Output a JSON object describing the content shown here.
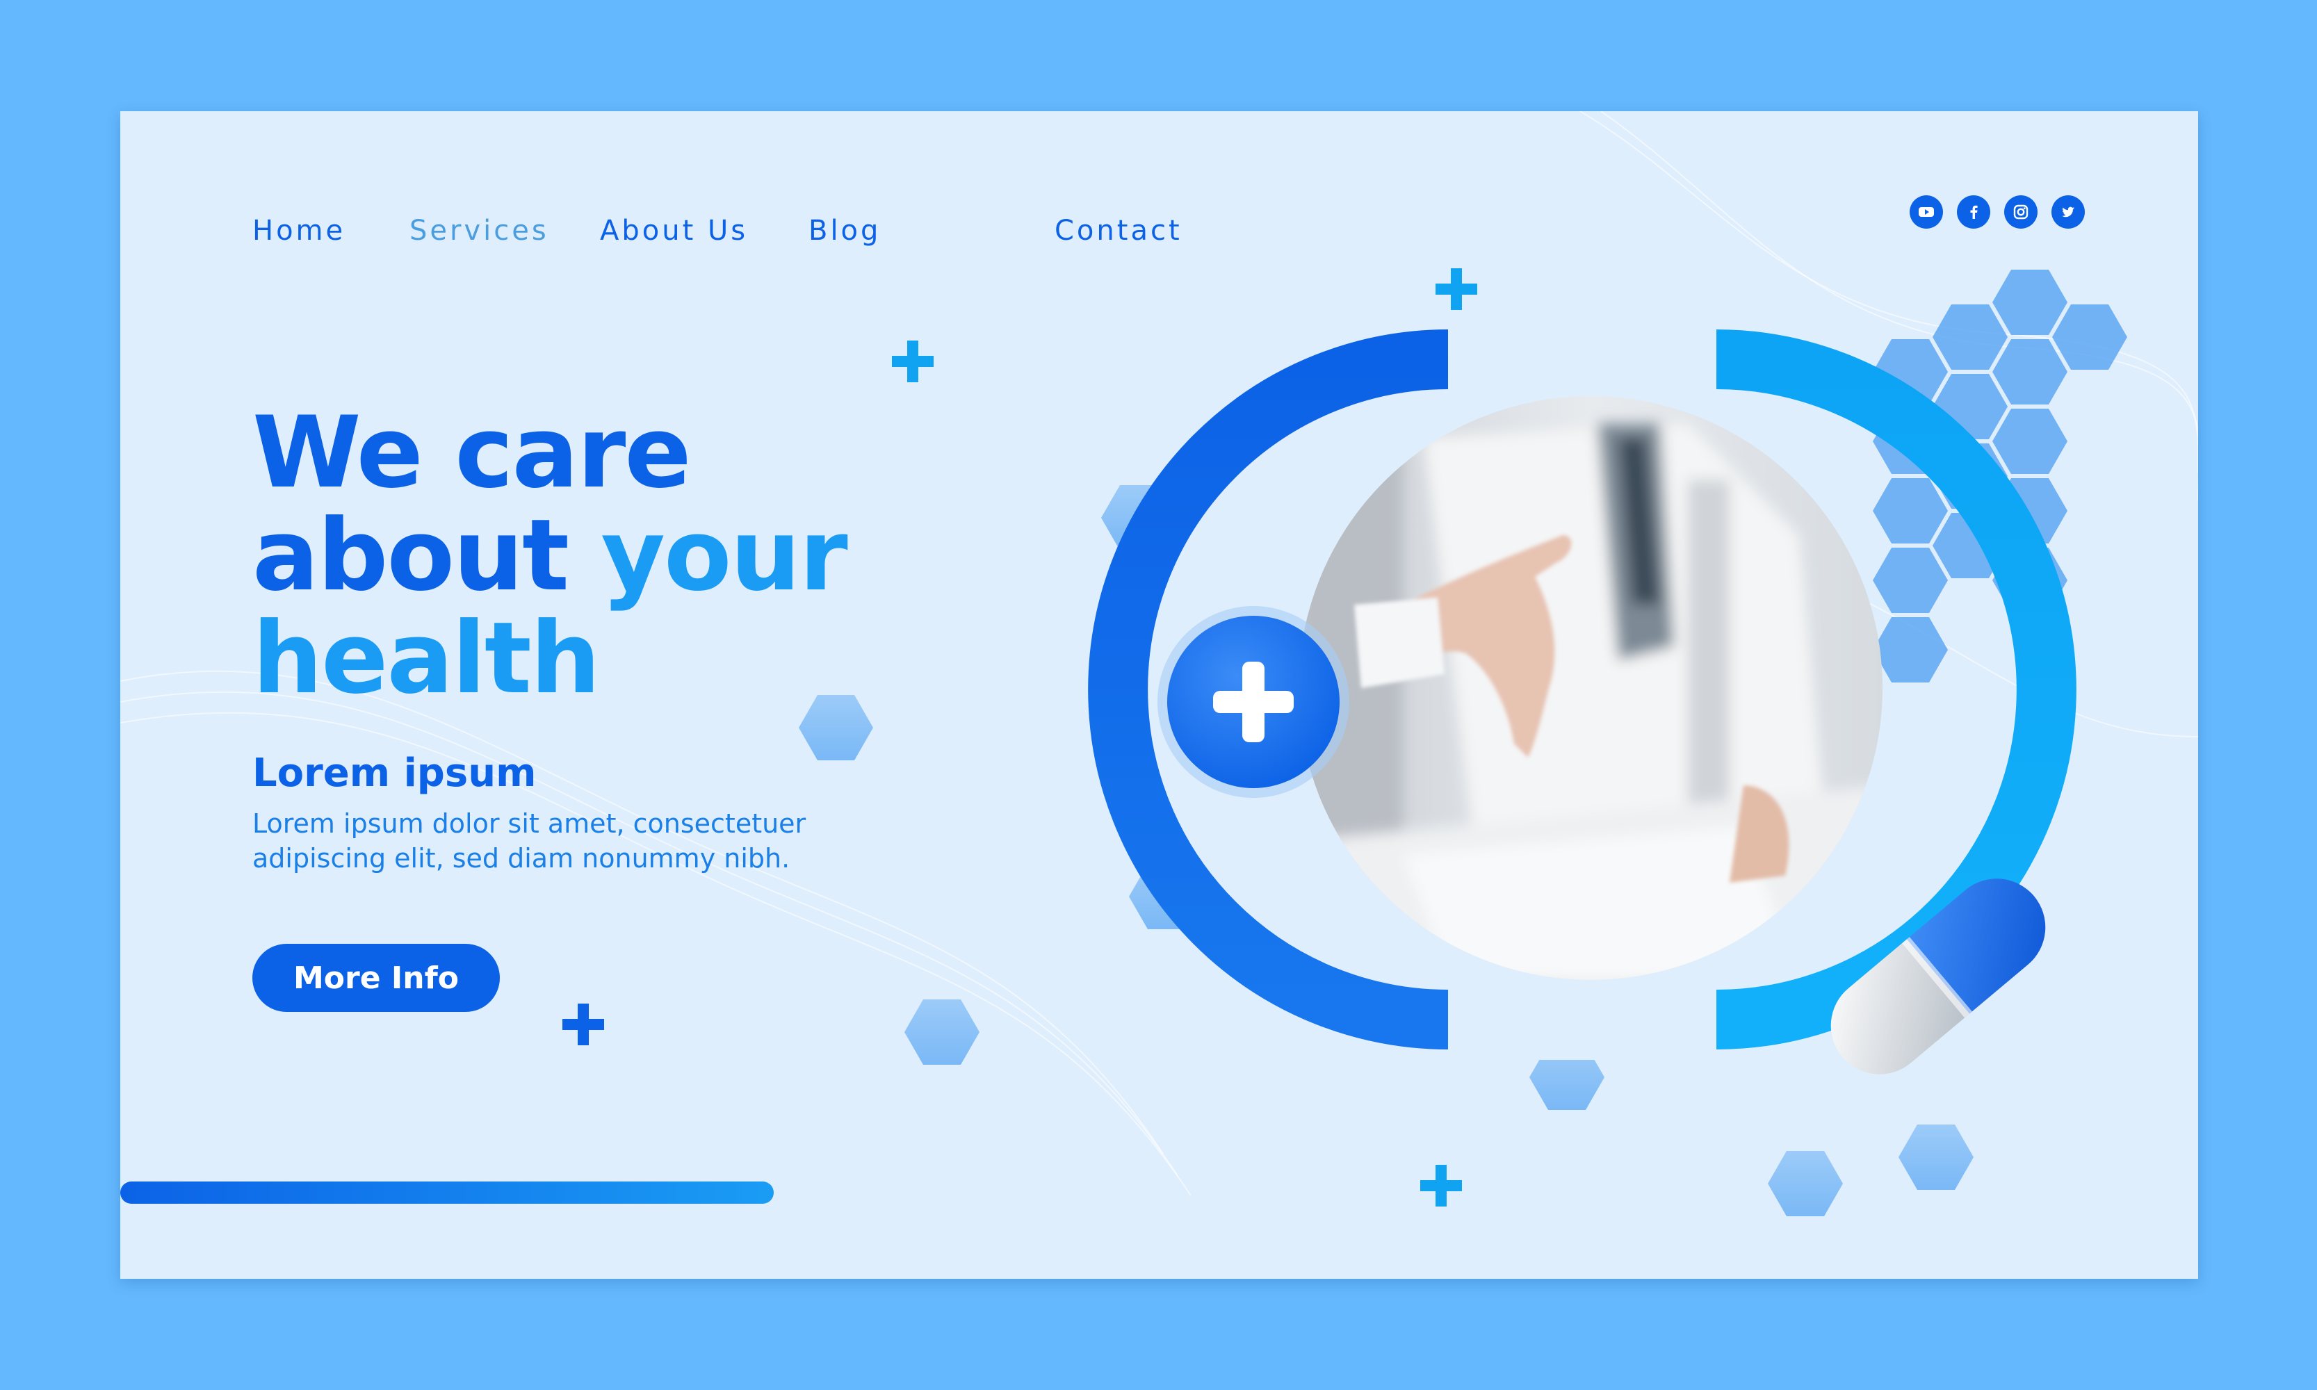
{
  "nav": {
    "items": [
      {
        "label": "Home",
        "active": false
      },
      {
        "label": "Services",
        "active": true
      },
      {
        "label": "About Us",
        "active": false
      },
      {
        "label": "Blog",
        "active": false
      },
      {
        "label": "Contact",
        "active": false
      }
    ]
  },
  "social": [
    {
      "icon": "youtube-icon"
    },
    {
      "icon": "facebook-icon"
    },
    {
      "icon": "instagram-icon"
    },
    {
      "icon": "twitter-icon"
    }
  ],
  "hero": {
    "title_line1": "We care",
    "title_line2_a": "about ",
    "title_line2_b": "your",
    "title_line3": "health",
    "subtitle": "Lorem ipsum",
    "description": "Lorem ipsum dolor sit amet, consectetuer adipiscing elit, sed diam nonummy nibh.",
    "cta_label": "More Info"
  },
  "colors": {
    "page_bg": "#64b8fd",
    "card_bg": "#dfeefc",
    "primary": "#0c62e6",
    "accent": "#1a9cf4",
    "nav_active": "#4a9ee0",
    "nav_text": "#0c62e6"
  }
}
